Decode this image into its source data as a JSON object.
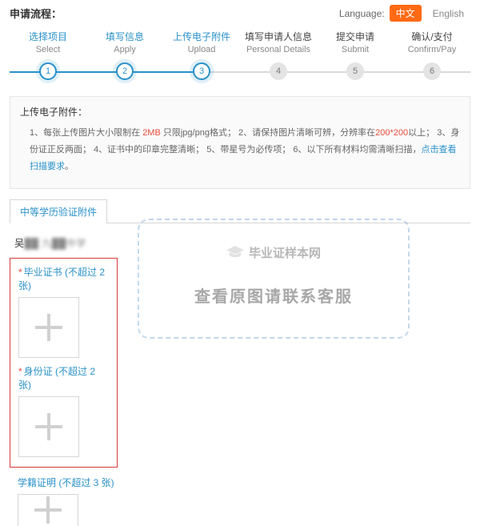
{
  "header": {
    "title": "申请流程：",
    "language_label": "Language:",
    "lang_zh": "中文",
    "lang_en": "English"
  },
  "steps": [
    {
      "cn": "选择项目",
      "en": "Select",
      "num": "1",
      "state": "done"
    },
    {
      "cn": "填写信息",
      "en": "Apply",
      "num": "2",
      "state": "done"
    },
    {
      "cn": "上传电子附件",
      "en": "Upload",
      "num": "3",
      "state": "done"
    },
    {
      "cn": "填写申请人信息",
      "en": "Personal Details",
      "num": "4",
      "state": "pending"
    },
    {
      "cn": "提交申请",
      "en": "Submit",
      "num": "5",
      "state": "pending"
    },
    {
      "cn": "确认/支付",
      "en": "Confirm/Pay",
      "num": "6",
      "state": "pending"
    }
  ],
  "instructions": {
    "title": "上传电子附件：",
    "p1_a": "1、每张上传图片大小限制在 ",
    "p1_size": "2MB",
    "p1_b": " 只限jpg/png格式；   2、请保持图片清晰可辨，分辨率在",
    "p1_res": "200*200",
    "p1_c": "以上；   3、身份证正反两面；   4、证书中的印章完整清晰；   5、带星号为必传项；   6、以下所有材料均需清晰扫描，",
    "p1_link": "点击查看扫描要求",
    "p1_d": "。"
  },
  "tab": {
    "label": "中等学历验证附件"
  },
  "applicant": {
    "name_visible": "吴",
    "name_hidden": "██ 九██中学"
  },
  "groups": {
    "g1": {
      "label": "毕业证书 (不超过 2 张)"
    },
    "g2": {
      "label": "身份证 (不超过 2 张)"
    },
    "g3": {
      "label": "学籍证明 (不超过 3 张)"
    }
  },
  "watermark": {
    "line1": "毕业证样本网",
    "line2": "查看原图请联系客服"
  }
}
